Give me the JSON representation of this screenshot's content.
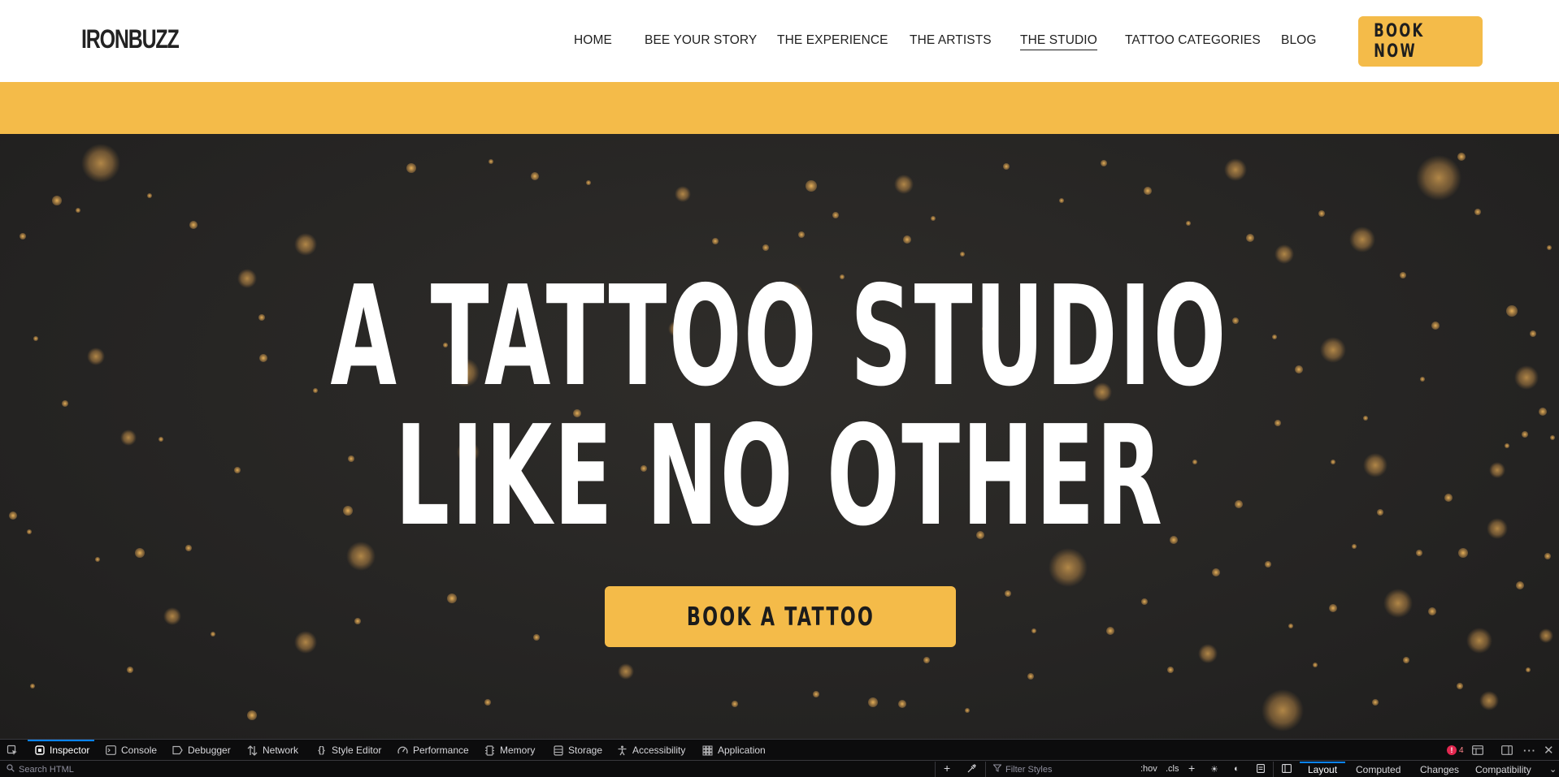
{
  "header": {
    "logo": "IRONBUZZ",
    "nav": [
      {
        "label": "HOME"
      },
      {
        "label": "BEE YOUR STORY"
      },
      {
        "label": "THE EXPERIENCE"
      },
      {
        "label": "THE ARTISTS"
      },
      {
        "label": "THE STUDIO",
        "active": true
      },
      {
        "label": "TATTOO CATEGORIES"
      },
      {
        "label": "BLOG"
      }
    ],
    "book_now_label": "BOOK NOW"
  },
  "hero": {
    "title_line1": "A TATTOO STUDIO",
    "title_line2": "LIKE NO OTHER",
    "cta_label": "BOOK A TATTOO"
  },
  "colors": {
    "accent": "#f4bb49",
    "hero_bg": "#262524",
    "text_light": "#ffffff",
    "text_dark": "#1f1f1f"
  },
  "devtools": {
    "tabs": [
      {
        "label": "Inspector",
        "icon": "inspector-icon",
        "active": true
      },
      {
        "label": "Console",
        "icon": "console-icon"
      },
      {
        "label": "Debugger",
        "icon": "debugger-icon"
      },
      {
        "label": "Network",
        "icon": "network-icon"
      },
      {
        "label": "Style Editor",
        "icon": "style-editor-icon"
      },
      {
        "label": "Performance",
        "icon": "performance-icon"
      },
      {
        "label": "Memory",
        "icon": "memory-icon"
      },
      {
        "label": "Storage",
        "icon": "storage-icon"
      },
      {
        "label": "Accessibility",
        "icon": "accessibility-icon"
      },
      {
        "label": "Application",
        "icon": "application-icon"
      }
    ],
    "error_count": "4",
    "search_html_placeholder": "Search HTML",
    "filter_styles_placeholder": "Filter Styles",
    "hov_label": ":hov",
    "cls_label": ".cls",
    "side_tabs": [
      {
        "label": "Layout",
        "active": true
      },
      {
        "label": "Computed"
      },
      {
        "label": "Changes"
      },
      {
        "label": "Compatibility"
      }
    ]
  }
}
